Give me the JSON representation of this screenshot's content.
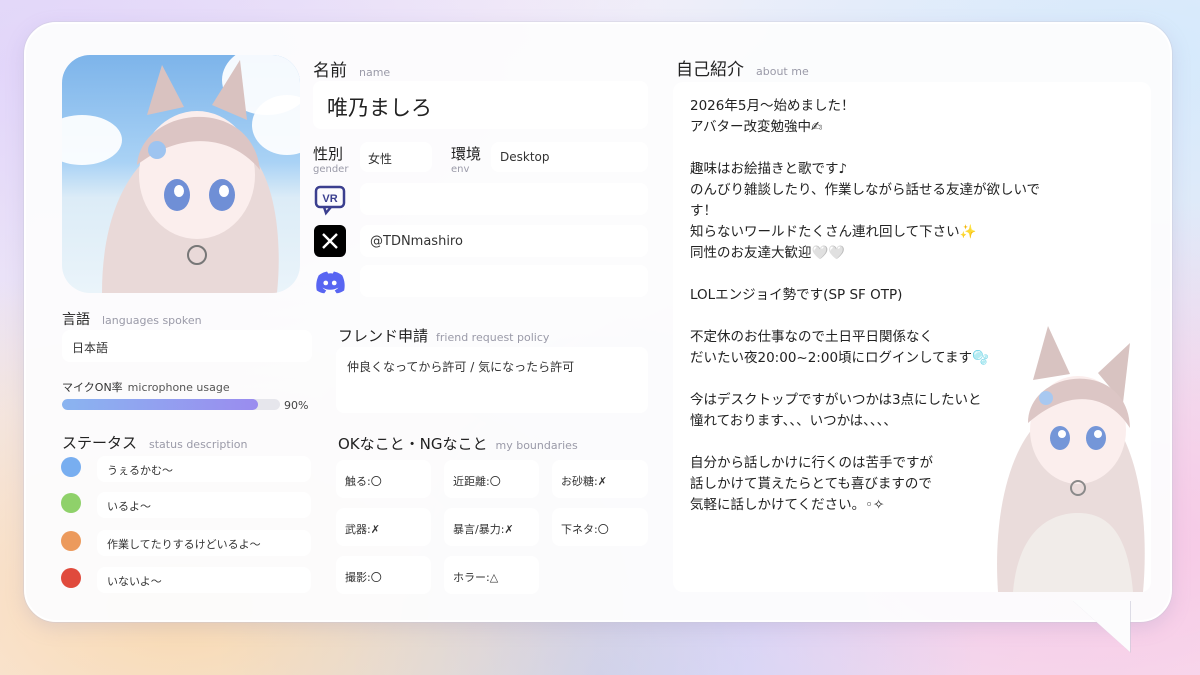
{
  "profile": {
    "name_label": "名前",
    "name_label_en": "name",
    "name_value": "唯乃ましろ",
    "gender_label": "性別",
    "gender_label_en": "gender",
    "gender_value": "女性",
    "env_label": "環境",
    "env_label_en": "env",
    "env_value": "Desktop",
    "vrchat_value": "",
    "x_handle": "@TDNmashiro",
    "discord_value": ""
  },
  "languages": {
    "label": "言語",
    "label_en": "languages spoken",
    "value": "日本語"
  },
  "mic": {
    "label": "マイクON率",
    "label_en": "microphone usage",
    "percent_text": "90%",
    "fraction": 0.9
  },
  "status": {
    "label": "ステータス",
    "label_en": "status description",
    "items": [
      {
        "color": "#78aef0",
        "text": "うぇるかむ〜"
      },
      {
        "color": "#8fd16a",
        "text": "いるよ〜"
      },
      {
        "color": "#ec9a5c",
        "text": "作業してたりするけどいるよ〜"
      },
      {
        "color": "#e04a3c",
        "text": "いないよ〜"
      }
    ]
  },
  "friend_request": {
    "label": "フレンド申請",
    "label_en": "friend request policy",
    "value": "仲良くなってから許可 / 気になったら許可"
  },
  "boundaries": {
    "label": "OKなこと・NGなこと",
    "label_en": "my boundaries",
    "items": [
      "触る:〇",
      "近距離:〇",
      "お砂糖:✗",
      "武器:✗",
      "暴言/暴力:✗",
      "下ネタ:〇",
      "撮影:〇",
      "ホラー:△"
    ]
  },
  "about": {
    "label": "自己紹介",
    "label_en": "about me",
    "text": "2026年5月〜始めました！\nアバター改変勉強中✍\n\n趣味はお絵描きと歌です♪\nのんびり雑談したり、作業しながら話せる友達が欲しいです！\n知らないワールドたくさん連れ回して下さい✨\n同性のお友達大歓迎🤍🤍\n\nLOLエンジョイ勢です(SP SF OTP)\n\n不定休のお仕事なので土日平日関係なく\nだいたい夜20:00~2:00頃にログインしてます🫧\n\n今はデスクトップですがいつかは3点にしたいと\n憧れております、、、いつかは、、、、\n\n自分から話しかけに行くのは苦手ですが\n話しかけて貰えたらとても喜びますので\n気軽に話しかけてください。◦✧"
  },
  "icons": {
    "vrchat": "vrchat-icon",
    "x": "x-logo-icon",
    "discord": "discord-icon"
  },
  "colors": {
    "accent": "#9a8cef",
    "vrchat": "#3b3f8f",
    "discord": "#5865f2"
  }
}
